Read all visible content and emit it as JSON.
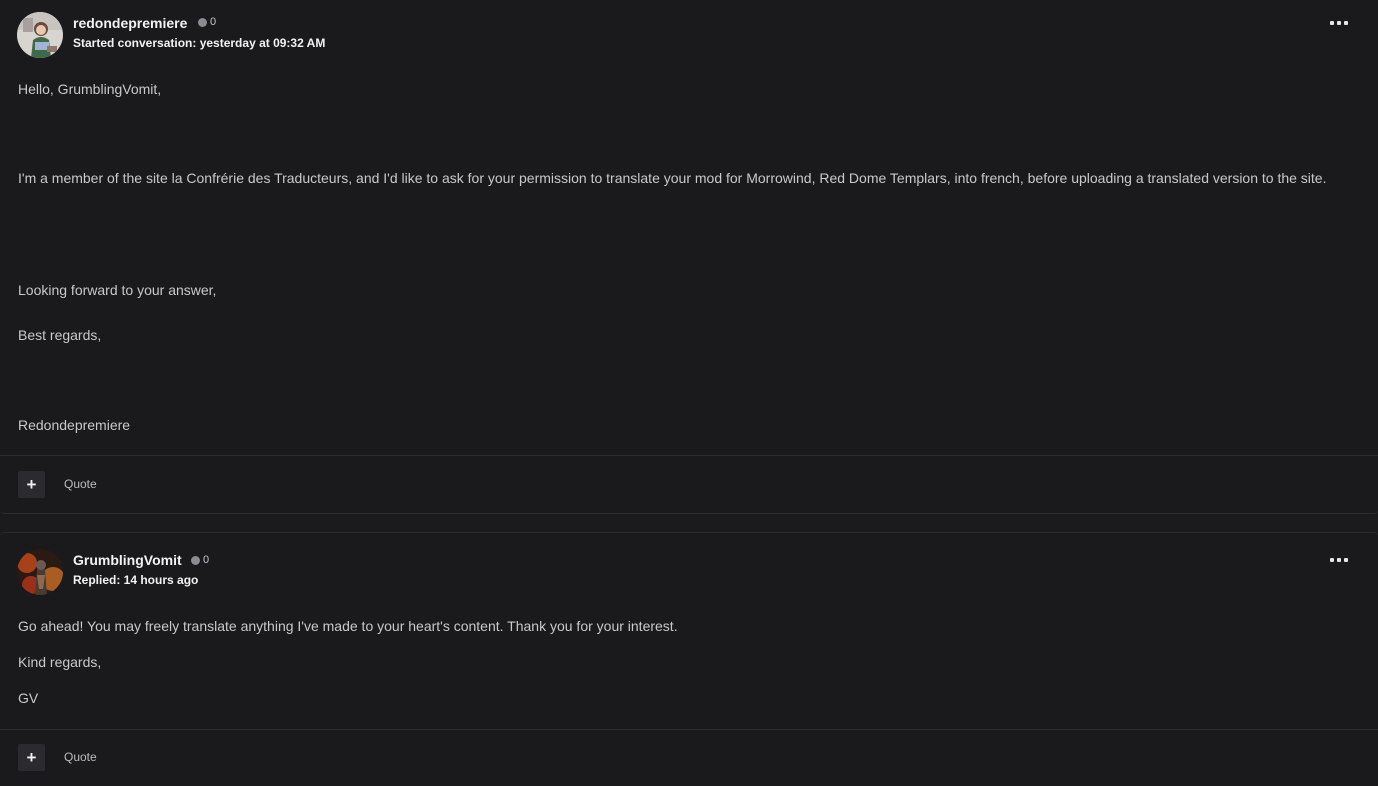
{
  "posts": [
    {
      "username": "redondepremiere",
      "reputation": "0",
      "meta": "Started conversation: yesterday at 09:32 AM",
      "paragraphs": [
        "Hello, GrumblingVomit,",
        "I'm a member of the site la Confrérie des Traducteurs, and I'd like to ask for your permission to translate your mod for Morrowind, Red Dome Templars, into french, before uploading a translated version to the site.",
        "Looking forward to your answer,",
        "Best regards,",
        "Redondepremiere"
      ],
      "plus_label": "+",
      "quote_label": "Quote",
      "avatar_icon": "avatar-illustration",
      "more_icon": "ellipsis-icon"
    },
    {
      "username": "GrumblingVomit",
      "reputation": "0",
      "meta": "Replied: 14 hours ago",
      "paragraphs": [
        "Go ahead! You may freely translate anything I've made to your heart's content. Thank you for your interest.",
        "Kind regards,",
        "GV"
      ],
      "plus_label": "+",
      "quote_label": "Quote",
      "avatar_icon": "avatar-fire",
      "more_icon": "ellipsis-icon"
    }
  ],
  "colors": {
    "background": "#1a1a1c",
    "text": "#c9c9cc",
    "username": "#f2f2f4",
    "divider": "#2c2c30",
    "button_bg": "#2b2b2f"
  }
}
